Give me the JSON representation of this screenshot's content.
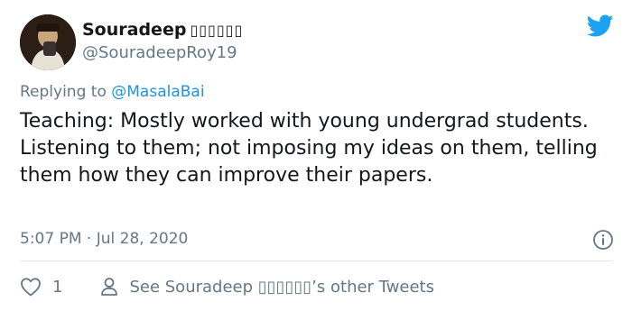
{
  "author": {
    "display_name": "Souradeep",
    "display_name_glyphs": "▯▯▯▯▯▯",
    "handle": "@SouradeepRoy19"
  },
  "reply": {
    "prefix": "Replying to",
    "mention": "@MasalaBai"
  },
  "tweet": {
    "text": "Teaching: Mostly worked with young undergrad students. Listening to them; not imposing my ideas on them, telling them how they can improve their papers.",
    "timestamp": "5:07 PM · Jul 28, 2020"
  },
  "actions": {
    "like_count": "1",
    "other_tweets_label": "See Souradeep ▯▯▯▯▯▯’s other Tweets"
  },
  "colors": {
    "brand": "#1da1f2",
    "secondary_text": "#657786",
    "link": "#1b95e0"
  },
  "icons": {
    "brand": "twitter-bird-icon",
    "info": "info-icon",
    "like": "heart-icon",
    "profile": "person-icon"
  }
}
